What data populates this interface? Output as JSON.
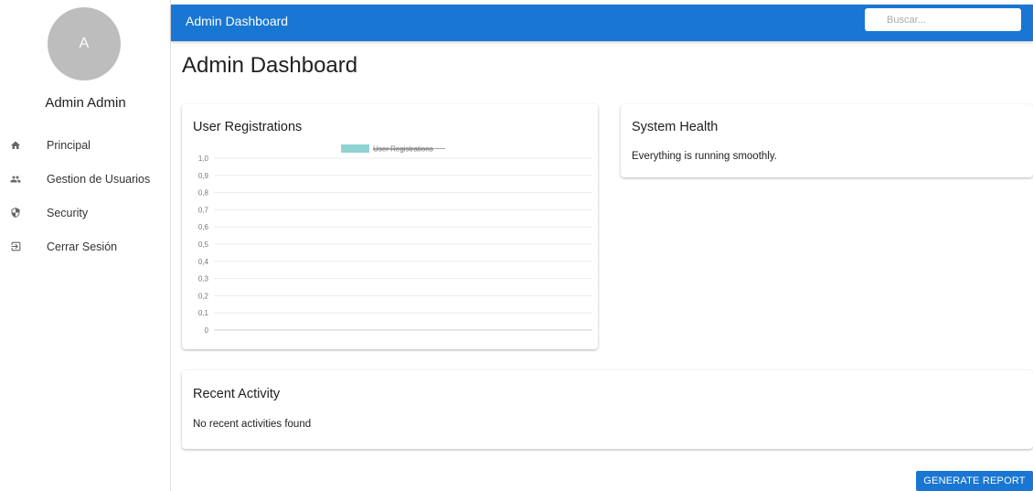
{
  "sidebar": {
    "avatar_initial": "A",
    "user_name": "Admin Admin",
    "items": [
      {
        "label": "Principal",
        "icon": "home-icon"
      },
      {
        "label": "Gestion de Usuarios",
        "icon": "people-icon"
      },
      {
        "label": "Security",
        "icon": "shield-icon"
      },
      {
        "label": "Cerrar Sesión",
        "icon": "logout-icon"
      }
    ]
  },
  "topbar": {
    "title": "Admin Dashboard",
    "search_placeholder": "Buscar..."
  },
  "main": {
    "page_title": "Admin Dashboard",
    "registrations_card": {
      "title": "User Registrations"
    },
    "health_card": {
      "title": "System Health",
      "message": "Everything is running smoothly."
    },
    "activity_card": {
      "title": "Recent Activity",
      "message": "No recent activities found"
    },
    "report_button": "GENERATE REPORT"
  },
  "colors": {
    "primary": "#1976d2",
    "series": "#8fd3d3",
    "avatar": "#bdbdbd"
  },
  "chart_data": {
    "type": "bar",
    "title": "",
    "categories": [],
    "series": [
      {
        "name": "User Registrations",
        "values": [],
        "hidden": true
      }
    ],
    "ylim": [
      0,
      1.0
    ],
    "yticks": [
      "1,0",
      "0,9",
      "0,8",
      "0,7",
      "0,6",
      "0,5",
      "0,4",
      "0,3",
      "0,2",
      "0,1",
      "0"
    ],
    "grid": true,
    "legend": "top-center"
  }
}
